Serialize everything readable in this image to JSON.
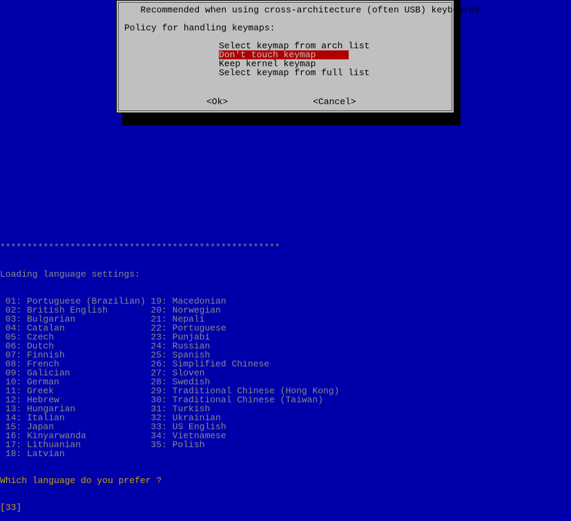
{
  "dialog": {
    "desc": "   Recommended when using cross-architecture (often USB) keyboards.",
    "policy": "Policy for handling keymaps:",
    "options": [
      {
        "label": "Select keymap from arch list",
        "selected": false
      },
      {
        "label": "Don't touch keymap",
        "selected": true
      },
      {
        "label": "Keep kernel keymap",
        "selected": false
      },
      {
        "label": "Select keymap from full list",
        "selected": false
      }
    ],
    "ok": "<Ok>",
    "cancel": "<Cancel>"
  },
  "terminal": {
    "stars": "****************************************************",
    "loading": "Loading language settings:",
    "col1": [
      " 01: Portuguese (Brazilian)",
      " 02: British English",
      " 03: Bulgarian",
      " 04: Catalan",
      " 05: Czech",
      " 06: Dutch",
      " 07: Finnish",
      " 08: French",
      " 09: Galician",
      " 10: German",
      " 11: Greek",
      " 12: Hebrew",
      " 13: Hungarian",
      " 14: Italian",
      " 15: Japan",
      " 16: Kinyarwanda",
      " 17: Lithuanian",
      " 18: Latvian"
    ],
    "col2": [
      "19: Macedonian",
      "20: Norwegian",
      "21: Nepali",
      "22: Portuguese",
      "23: Punjabi",
      "24: Russian",
      "25: Spanish",
      "26: Simplified Chinese",
      "27: Sloven",
      "28: Swedish",
      "29: Traditional Chinese (Hong Kong)",
      "30: Traditional Chinese (Taiwan)",
      "31: Turkish",
      "32: Ukrainian",
      "33: US English",
      "34: Vietnamese",
      "35: Polish",
      ""
    ],
    "prompt": "Which language do you prefer ?",
    "input": "[33]"
  }
}
